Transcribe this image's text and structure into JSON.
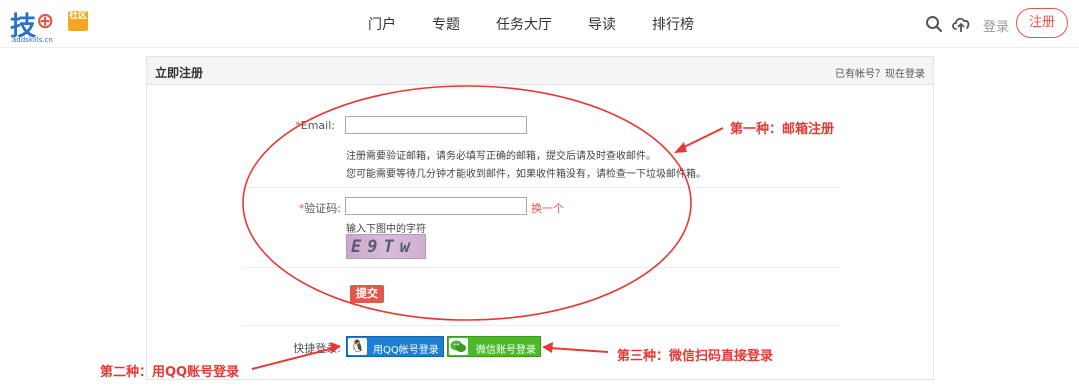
{
  "header": {
    "logo": {
      "main": "技",
      "badge": "社区",
      "domain": "addskills.cn"
    },
    "nav": [
      "门户",
      "专题",
      "任务大厅",
      "导读",
      "排行榜"
    ],
    "login": "登录",
    "register": "注册"
  },
  "panel": {
    "title": "立即注册",
    "has_account": "已有帐号？现在登录",
    "email": {
      "required_mark": "*",
      "label": "Email:",
      "value": "",
      "hint1": "注册需要验证邮箱，请务必填写正确的邮箱，提交后请及时查收邮件。",
      "hint2": "您可能需要等待几分钟才能收到邮件，如果收件箱没有，请检查一下垃圾邮件箱。"
    },
    "captcha": {
      "required_mark": "*",
      "label": "验证码:",
      "value": "",
      "refresh": "换一个",
      "hint": "输入下图中的字符",
      "image_text": "E9Tw"
    },
    "submit": "提交",
    "quick_login": {
      "label": "快捷登录:",
      "qq": "用QQ帐号登录",
      "wechat": "微信账号登录"
    }
  },
  "annotations": {
    "first": "第一种：邮箱注册",
    "second": "第二种：用QQ账号登录",
    "third": "第三种：微信扫码直接登录",
    "color": "#e53935"
  },
  "colors": {
    "accent": "#e2574c",
    "qq": "#1e7fd1",
    "wechat": "#4cb82a"
  },
  "icons": [
    "search-icon",
    "upload-cloud-icon",
    "qq-penguin-icon",
    "wechat-icon"
  ]
}
